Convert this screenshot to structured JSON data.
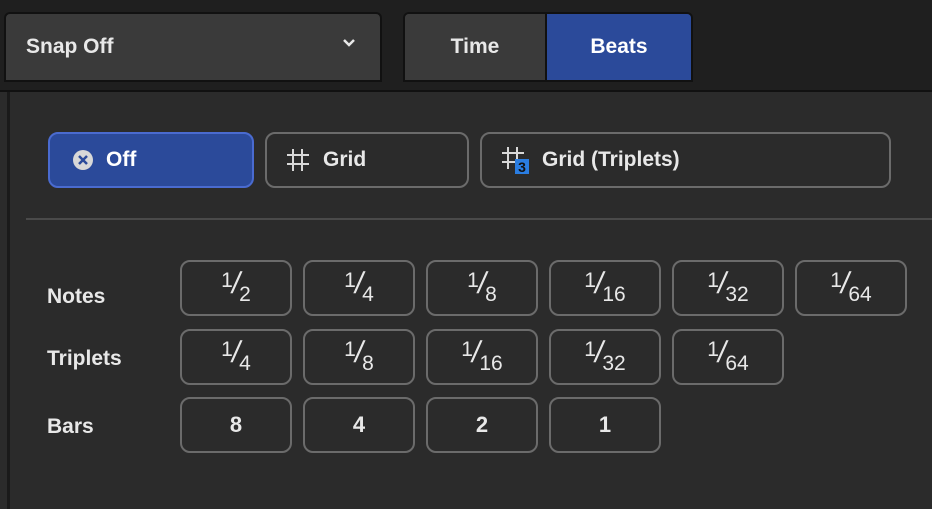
{
  "snap_dropdown": {
    "label": "Snap Off"
  },
  "tabs": [
    {
      "label": "Time"
    },
    {
      "label": "Beats"
    }
  ],
  "modes": [
    {
      "label": "Off"
    },
    {
      "label": "Grid"
    },
    {
      "label": "Grid (Triplets)"
    }
  ],
  "triplet_icon_digit": "3",
  "accent_color": "#2b4a9a",
  "rows": {
    "notes": {
      "label": "Notes",
      "values": [
        {
          "n": "1",
          "d": "2"
        },
        {
          "n": "1",
          "d": "4"
        },
        {
          "n": "1",
          "d": "8"
        },
        {
          "n": "1",
          "d": "16"
        },
        {
          "n": "1",
          "d": "32"
        },
        {
          "n": "1",
          "d": "64"
        }
      ]
    },
    "triplets": {
      "label": "Triplets",
      "values": [
        {
          "n": "1",
          "d": "4"
        },
        {
          "n": "1",
          "d": "8"
        },
        {
          "n": "1",
          "d": "16"
        },
        {
          "n": "1",
          "d": "32"
        },
        {
          "n": "1",
          "d": "64"
        }
      ]
    },
    "bars": {
      "label": "Bars",
      "values": [
        "8",
        "4",
        "2",
        "1"
      ]
    }
  }
}
